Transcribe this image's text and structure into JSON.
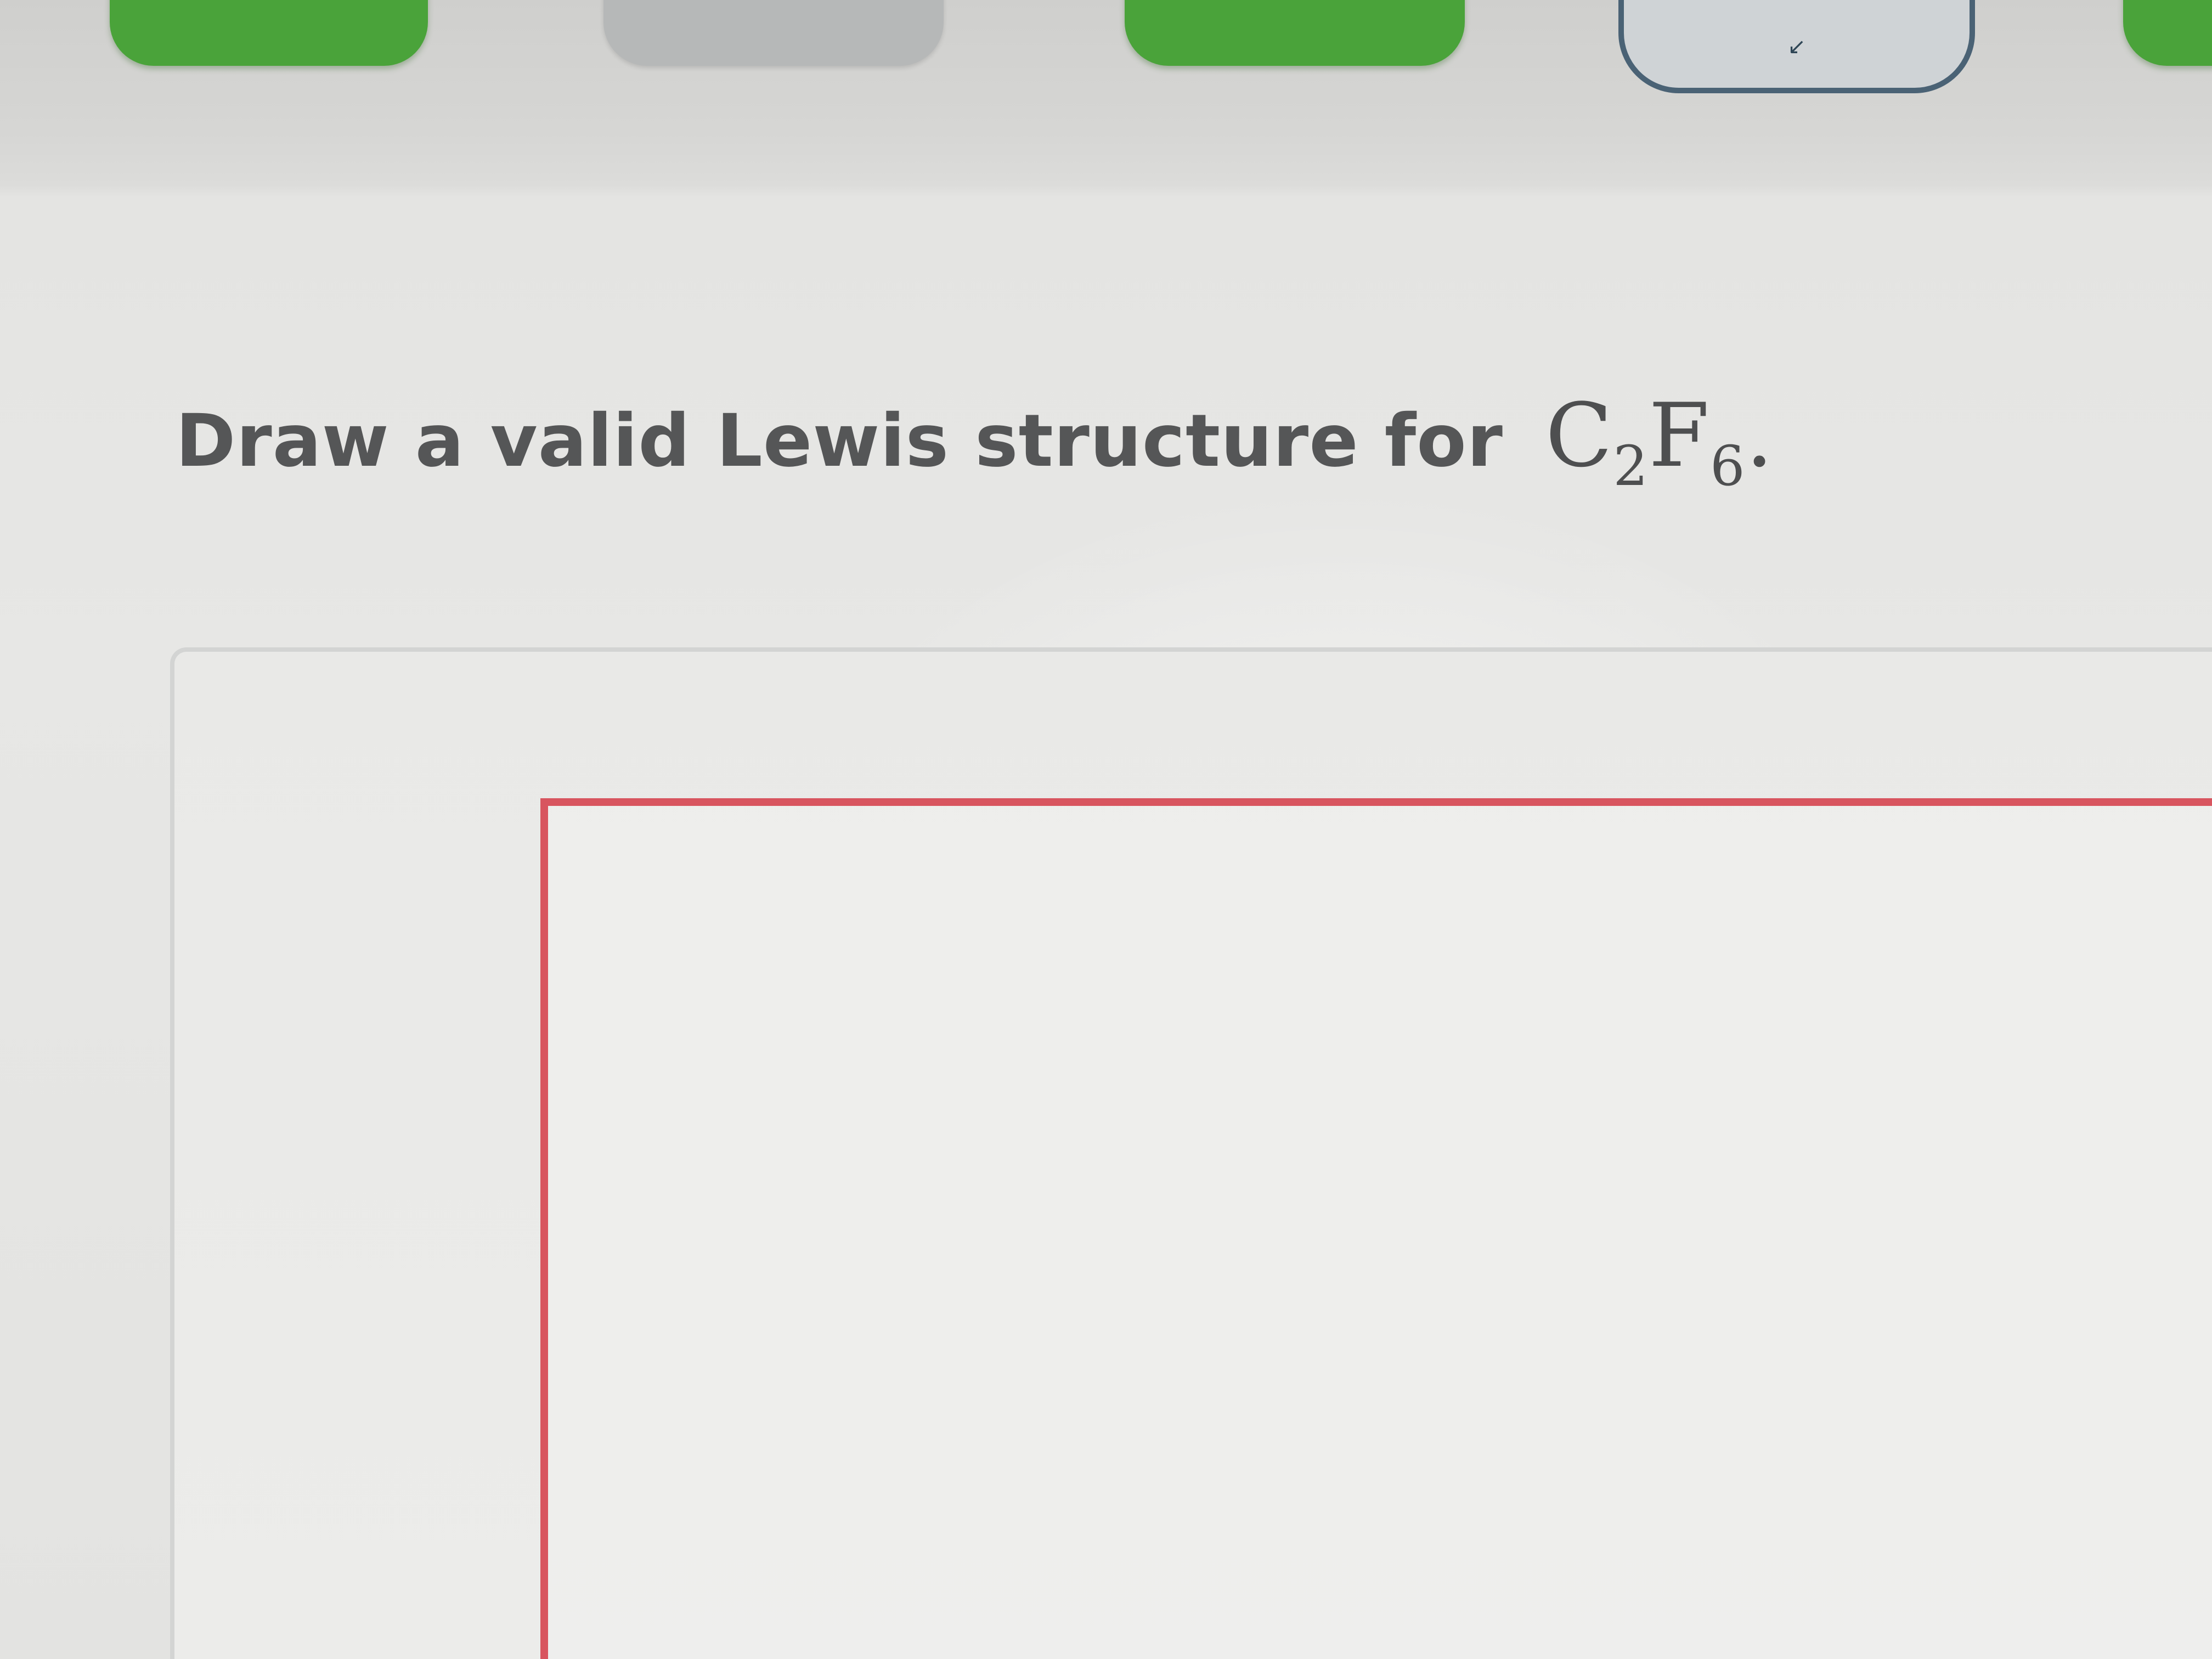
{
  "toolbar": {
    "buttons": [
      {
        "name": "tool-button-1",
        "style": "green"
      },
      {
        "name": "tool-button-2",
        "style": "gray"
      },
      {
        "name": "tool-button-3",
        "style": "green"
      },
      {
        "name": "tool-button-4",
        "style": "outlined"
      },
      {
        "name": "tool-button-5",
        "style": "green"
      }
    ]
  },
  "question": {
    "prompt": "Draw a valid Lewis structure for",
    "formula": {
      "element1": "C",
      "subscript1": "2",
      "element2": "F",
      "subscript2": "6",
      "terminal": "."
    }
  },
  "colors": {
    "accent_green": "#4aa33a",
    "canvas_border_red": "#d8555f",
    "outline_blue": "#4a6275"
  }
}
